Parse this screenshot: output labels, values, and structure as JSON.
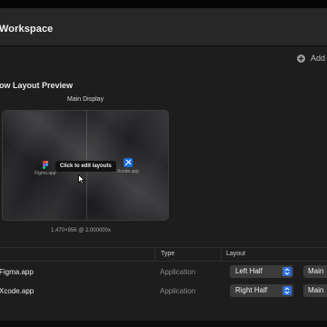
{
  "window": {
    "title": "Workspace"
  },
  "toolbar": {
    "add_label": "Add"
  },
  "preview": {
    "section_title": "ow Layout Preview",
    "display_label": "Main Display",
    "edit_hint": "Click to edit layouts",
    "resolution": "1,470×956 @ 2.000000x",
    "apps": [
      {
        "name": "Figma.app",
        "icon": "figma-icon"
      },
      {
        "name": "Xcode.app",
        "icon": "xcode-icon"
      }
    ]
  },
  "table": {
    "columns": {
      "type": "Type",
      "layout": "Layout"
    },
    "rows": [
      {
        "app": "Figma.app",
        "type": "Application",
        "layout": "Left Half",
        "display": "Main"
      },
      {
        "app": "Xcode.app",
        "type": "Application",
        "layout": "Right Half",
        "display": "Main"
      }
    ]
  },
  "colors": {
    "accent": "#2f6fd6",
    "background": "#1d1d1d"
  }
}
